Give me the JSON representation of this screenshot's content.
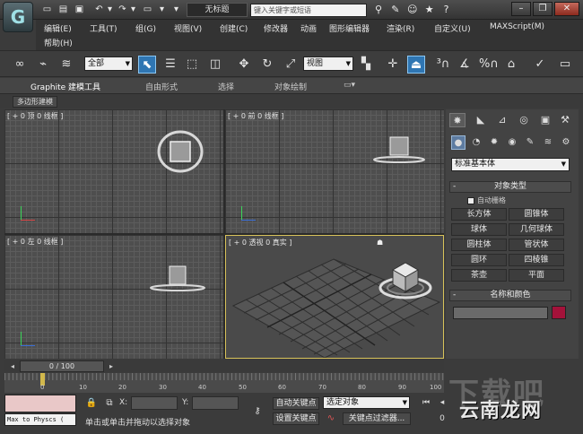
{
  "titlebar": {
    "document_title": "无标题",
    "search_placeholder": "键入关键字或短语"
  },
  "menubar": {
    "items": [
      "编辑(E)",
      "工具(T)",
      "组(G)",
      "视图(V)",
      "创建(C)",
      "修改器",
      "动画",
      "图形编辑器",
      "渲染(R)",
      "自定义(U)",
      "MAXScript(M)",
      "帮助(H)"
    ]
  },
  "toolbar": {
    "selection_filter": "全部",
    "ref_coord": "视图"
  },
  "ribbon": {
    "tabs": [
      "Graphite 建模工具",
      "自由形式",
      "选择",
      "对象绘制"
    ],
    "sub_label": "多边形建模"
  },
  "viewports": {
    "top": "[ + 0 顶 0 线框 ]",
    "front": "[ + 0 前 0 线框 ]",
    "left": "[ + 0 左 0 线框 ]",
    "perspective": "[ + 0 透视 0 真实 ]"
  },
  "command_panel": {
    "category": "标准基本体",
    "object_type_title": "对象类型",
    "autogrid_label": "自动栅格",
    "primitives": [
      "长方体",
      "圆锥体",
      "球体",
      "几何球体",
      "圆柱体",
      "管状体",
      "圆环",
      "四棱锥",
      "茶壶",
      "平面"
    ],
    "name_color_title": "名称和颜色",
    "color": "#a4123a"
  },
  "timeline": {
    "slider_label": "0 / 100",
    "ticks": [
      "0",
      "10",
      "20",
      "30",
      "40",
      "50",
      "60",
      "70",
      "80",
      "90",
      "100"
    ]
  },
  "statusbar": {
    "maxscript_text": "Max to Physcs (",
    "x_label": "X:",
    "y_label": "Y:",
    "auto_key": "自动关键点",
    "set_key": "设置关键点",
    "selected_dropdown": "选定对象",
    "key_filters": "关键点过滤器...",
    "prompt": "单击或单击并拖动以选择对象"
  },
  "watermark": {
    "text": "云南龙网",
    "bg_text": "下载吧"
  }
}
